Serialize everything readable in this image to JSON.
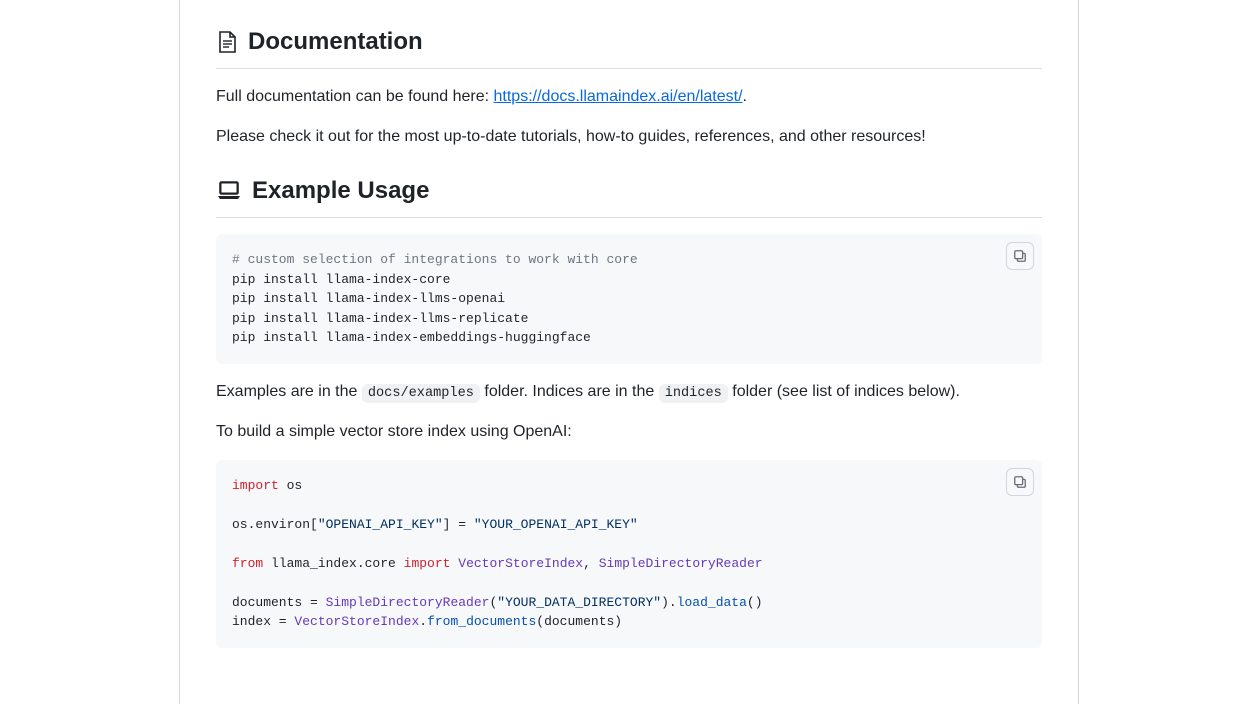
{
  "sections": {
    "documentation": {
      "heading": "Documentation",
      "intro_prefix": "Full documentation can be found here: ",
      "link_text": "https://docs.llamaindex.ai/en/latest/",
      "intro_suffix": ".",
      "followup": "Please check it out for the most up-to-date tutorials, how-to guides, references, and other resources!"
    },
    "example_usage": {
      "heading": "Example Usage",
      "code1": {
        "comment": "# custom selection of integrations to work with core",
        "line1": "pip install llama-index-core",
        "line2": "pip install llama-index-llms-openai",
        "line3": "pip install llama-index-llms-replicate",
        "line4": "pip install llama-index-embeddings-huggingface"
      },
      "examples_sentence": {
        "t1": "Examples are in the ",
        "code1": "docs/examples",
        "t2": " folder. Indices are in the ",
        "code2": "indices",
        "t3": " folder (see list of indices below)."
      },
      "build_sentence": "To build a simple vector store index using OpenAI:",
      "code2": {
        "l1_kw": "import",
        "l1_rest": " os",
        "l3_a": "os.environ[",
        "l3_str1": "\"OPENAI_API_KEY\"",
        "l3_b": "] = ",
        "l3_str2": "\"YOUR_OPENAI_API_KEY\"",
        "l5_kw1": "from",
        "l5_a": " llama_index.core ",
        "l5_kw2": "import",
        "l5_b": " ",
        "l5_cls1": "VectorStoreIndex",
        "l5_c": ", ",
        "l5_cls2": "SimpleDirectoryReader",
        "l7_a": "documents = ",
        "l7_cls": "SimpleDirectoryReader",
        "l7_b": "(",
        "l7_str": "\"YOUR_DATA_DIRECTORY\"",
        "l7_c": ").",
        "l7_fn": "load_data",
        "l7_d": "()",
        "l8_a": "index = ",
        "l8_cls": "VectorStoreIndex",
        "l8_b": ".",
        "l8_fn": "from_documents",
        "l8_c": "(documents)"
      }
    }
  }
}
